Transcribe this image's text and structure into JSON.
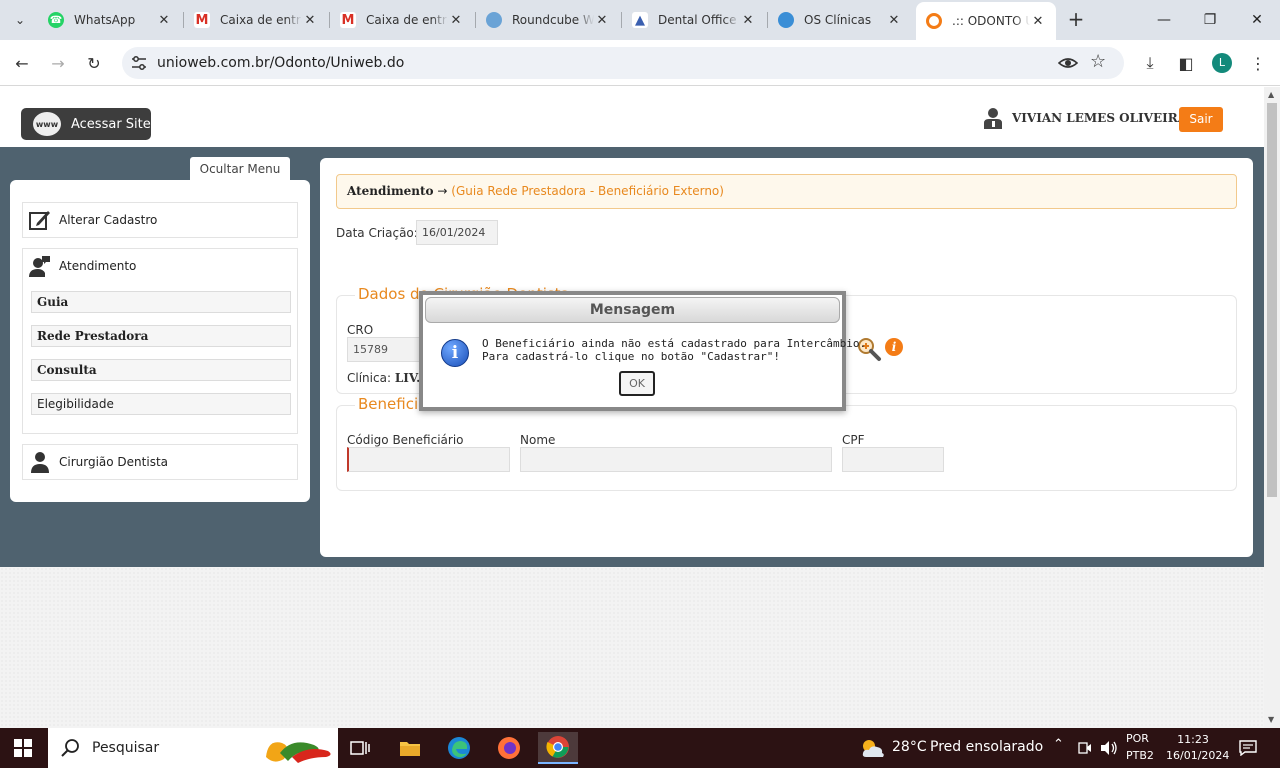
{
  "browser": {
    "tabs": [
      {
        "title": "WhatsApp",
        "icon": "whatsapp-icon"
      },
      {
        "title": "Caixa de entrada",
        "icon": "gmail-icon"
      },
      {
        "title": "Caixa de entrada",
        "icon": "gmail-icon"
      },
      {
        "title": "Roundcube Webmail",
        "icon": "roundcube-icon"
      },
      {
        "title": "Dental Office",
        "icon": "tooth-icon"
      },
      {
        "title": "OS Clínicas",
        "icon": "os-clinicas-icon"
      },
      {
        "title": ".:: ODONTO UNIWEB",
        "icon": "odonto-icon"
      }
    ],
    "url": "unioweb.com.br/Odonto/Uniweb.do",
    "profile_initial": "L"
  },
  "site": {
    "acessar_site": "Acessar Site",
    "www_badge": "www",
    "user_name": "VIVIAN LEMES OLIVEIRA",
    "sair": "Sair",
    "ocultar_menu": "Ocultar Menu"
  },
  "sidebar": {
    "alterar_cadastro": "Alterar Cadastro",
    "atendimento": "Atendimento",
    "sub_items": [
      "Guia",
      "Rede Prestadora",
      "Consulta",
      "Elegibilidade"
    ],
    "cirurgiao": "Cirurgião Dentista"
  },
  "main": {
    "breadcrumb_section": "Atendimento",
    "breadcrumb_arrow": "→",
    "breadcrumb_page": "(Guia Rede Prestadora - Beneficiário Externo)",
    "data_criacao_label": "Data Criação:",
    "data_criacao_value": "16/01/2024",
    "dados_legend": "Dados do Cirurgião Dentista",
    "cro_label": "CRO",
    "cro_value": "15789",
    "clinica_label": "Clínica:",
    "clinica_value": "LIV.",
    "beneficiario_legend": "Beneficiário",
    "codigo_label": "Código Beneficiário",
    "nome_label": "Nome",
    "cpf_label": "CPF",
    "info_glyph": "i"
  },
  "modal": {
    "title": "Mensagem",
    "line1": "O Beneficiário ainda não está cadastrado para Intercâmbio.",
    "line2": "Para cadastrá-lo clique no botão \"Cadastrar\"!",
    "ok": "OK",
    "icon_glyph": "i"
  },
  "taskbar": {
    "search_label": "Pesquisar",
    "temperature": "28°C",
    "weather": "Pred ensolarado",
    "lang1": "POR",
    "lang2": "PTB2",
    "time": "11:23",
    "date": "16/01/2024"
  },
  "colors": {
    "accent_orange": "#f47c16",
    "band": "#4f626f",
    "legend_orange": "#e8891f"
  }
}
